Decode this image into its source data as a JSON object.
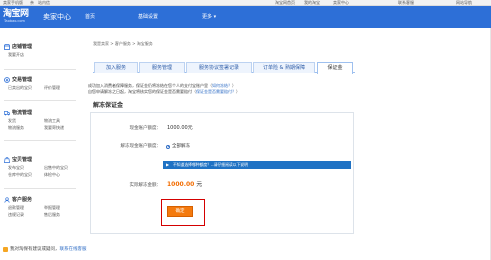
{
  "topbar": {
    "items": [
      "卖家手机版",
      "亲",
      "站内信",
      "淘宝网首页",
      "我的淘宝",
      "卖家中心",
      "联系客服",
      "网站导航"
    ]
  },
  "header": {
    "logo_cn": "淘宝网",
    "logo_en": "Taobao.com",
    "title": "卖家中心",
    "nav": [
      "首页",
      "基础设置",
      "更多"
    ],
    "nav_more_arrow": "▾"
  },
  "sidebar": {
    "groups": [
      {
        "title": "店铺管理",
        "icon": "store-icon",
        "links": [
          "我要开店"
        ]
      },
      {
        "title": "交易管理",
        "icon": "trade-icon",
        "links": [
          "已卖出的宝贝",
          "评价管理"
        ]
      },
      {
        "title": "物流管理",
        "icon": "logistics-icon",
        "links": [
          "发货",
          "物流工具",
          "物流服务",
          "我要寄快递"
        ]
      },
      {
        "title": "宝贝管理",
        "icon": "goods-icon",
        "links": [
          "发布宝贝",
          "出售中的宝贝",
          "仓库中的宝贝",
          "体检中心"
        ]
      },
      {
        "title": "客户服务",
        "icon": "service-icon",
        "links": [
          "退款管理",
          "举报管理",
          "违规记录",
          "售后服务"
        ]
      }
    ]
  },
  "breadcrumb": "我是卖家  >  客户服务  >  淘宝服务",
  "tabs": [
    "加入服务",
    "服务管理",
    "服务协议签署记录",
    "订单险 & 熟期保障",
    "保证金"
  ],
  "notice": {
    "line1": "成功加入消费者保障服务，保证金仍将冻结在您个人的支付宝账户里（",
    "line1_link": "如何冻结？",
    "line2": "自您申请解冻之日起，淘宝将核实您的保证金是否需要赔付（",
    "line2_link": "保证金是否需要赔付？"
  },
  "section_title": "解冻保证金",
  "form": {
    "current_label": "现金账户额度：",
    "current_value": "1000.00元",
    "unfreeze_label": "解冻现金账户额度：",
    "unfreeze_option": "全部解冻",
    "info_arrow": "▶",
    "info_text": "不知道选择哪种额度？--请仔细阅读以下说明",
    "actual_label": "实际解冻金额：",
    "actual_value": "1000.00",
    "actual_unit": "元"
  },
  "confirm_button": "确定",
  "bottom_tip": {
    "text": "我对淘保有建议或疑问，",
    "link": "联系在线客服"
  },
  "colors": {
    "header_blue": "#2d6fd7",
    "accent_orange": "#f47a0e",
    "highlight_red": "#d40000",
    "info_bar": "#1f72c4"
  }
}
